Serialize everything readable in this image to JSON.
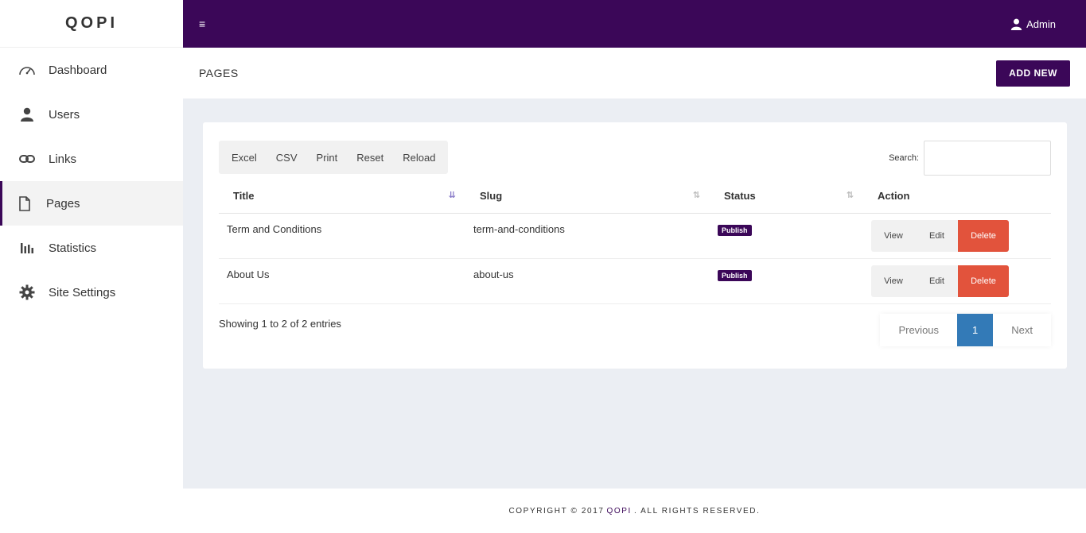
{
  "brand": "QOPI",
  "sidebar": {
    "items": [
      {
        "label": "Dashboard",
        "icon": "dashboard-icon"
      },
      {
        "label": "Users",
        "icon": "user-icon"
      },
      {
        "label": "Links",
        "icon": "link-icon"
      },
      {
        "label": "Pages",
        "icon": "file-icon",
        "active": true
      },
      {
        "label": "Statistics",
        "icon": "bar-chart-icon"
      },
      {
        "label": "Site Settings",
        "icon": "gear-icon"
      }
    ]
  },
  "topbar": {
    "menu_icon": "≡",
    "user_label": "Admin"
  },
  "header": {
    "title": "PAGES",
    "add_label": "ADD NEW"
  },
  "toolbar": {
    "buttons": [
      "Excel",
      "CSV",
      "Print",
      "Reset",
      "Reload"
    ]
  },
  "search": {
    "label": "Search:",
    "value": ""
  },
  "table": {
    "columns": [
      "Title",
      "Slug",
      "Status",
      "Action"
    ],
    "rows": [
      {
        "title": "Term and Conditions",
        "slug": "term-and-conditions",
        "status": "Publish"
      },
      {
        "title": "About Us",
        "slug": "about-us",
        "status": "Publish"
      }
    ],
    "actions": {
      "view": "View",
      "edit": "Edit",
      "delete": "Delete"
    }
  },
  "info": "Showing 1 to 2 of 2 entries",
  "pagination": {
    "previous": "Previous",
    "current": "1",
    "next": "Next"
  },
  "footer": {
    "prefix": "COPYRIGHT © 2017",
    "brand": "QOPI",
    "suffix": ". ALL RIGHTS RESERVED."
  },
  "colors": {
    "primary": "#3b0758",
    "danger": "#e2533c",
    "page_active": "#337ab7"
  }
}
